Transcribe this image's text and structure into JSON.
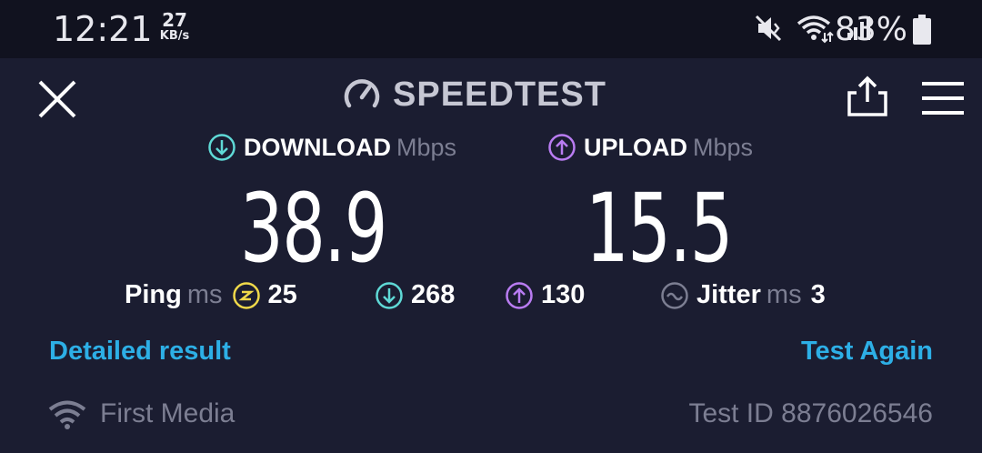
{
  "status_bar": {
    "time": "12:21",
    "net_speed_value": "27",
    "net_speed_unit": "KB/s",
    "battery": "83%"
  },
  "header": {
    "title": "SPEEDTEST"
  },
  "download": {
    "label": "DOWNLOAD",
    "unit": "Mbps",
    "value": "38.9",
    "color": "#5fd9d6"
  },
  "upload": {
    "label": "UPLOAD",
    "unit": "Mbps",
    "value": "15.5",
    "color": "#b97cf2"
  },
  "ping": {
    "label": "Ping",
    "unit": "ms",
    "idle": "25",
    "download": "268",
    "upload": "130",
    "idle_color": "#f0d94a"
  },
  "jitter": {
    "label": "Jitter",
    "unit": "ms",
    "value": "3"
  },
  "links": {
    "detailed": "Detailed result",
    "again": "Test Again",
    "color": "#2dafe6"
  },
  "footer": {
    "provider": "First Media",
    "test_id": "Test ID 8876026546"
  }
}
